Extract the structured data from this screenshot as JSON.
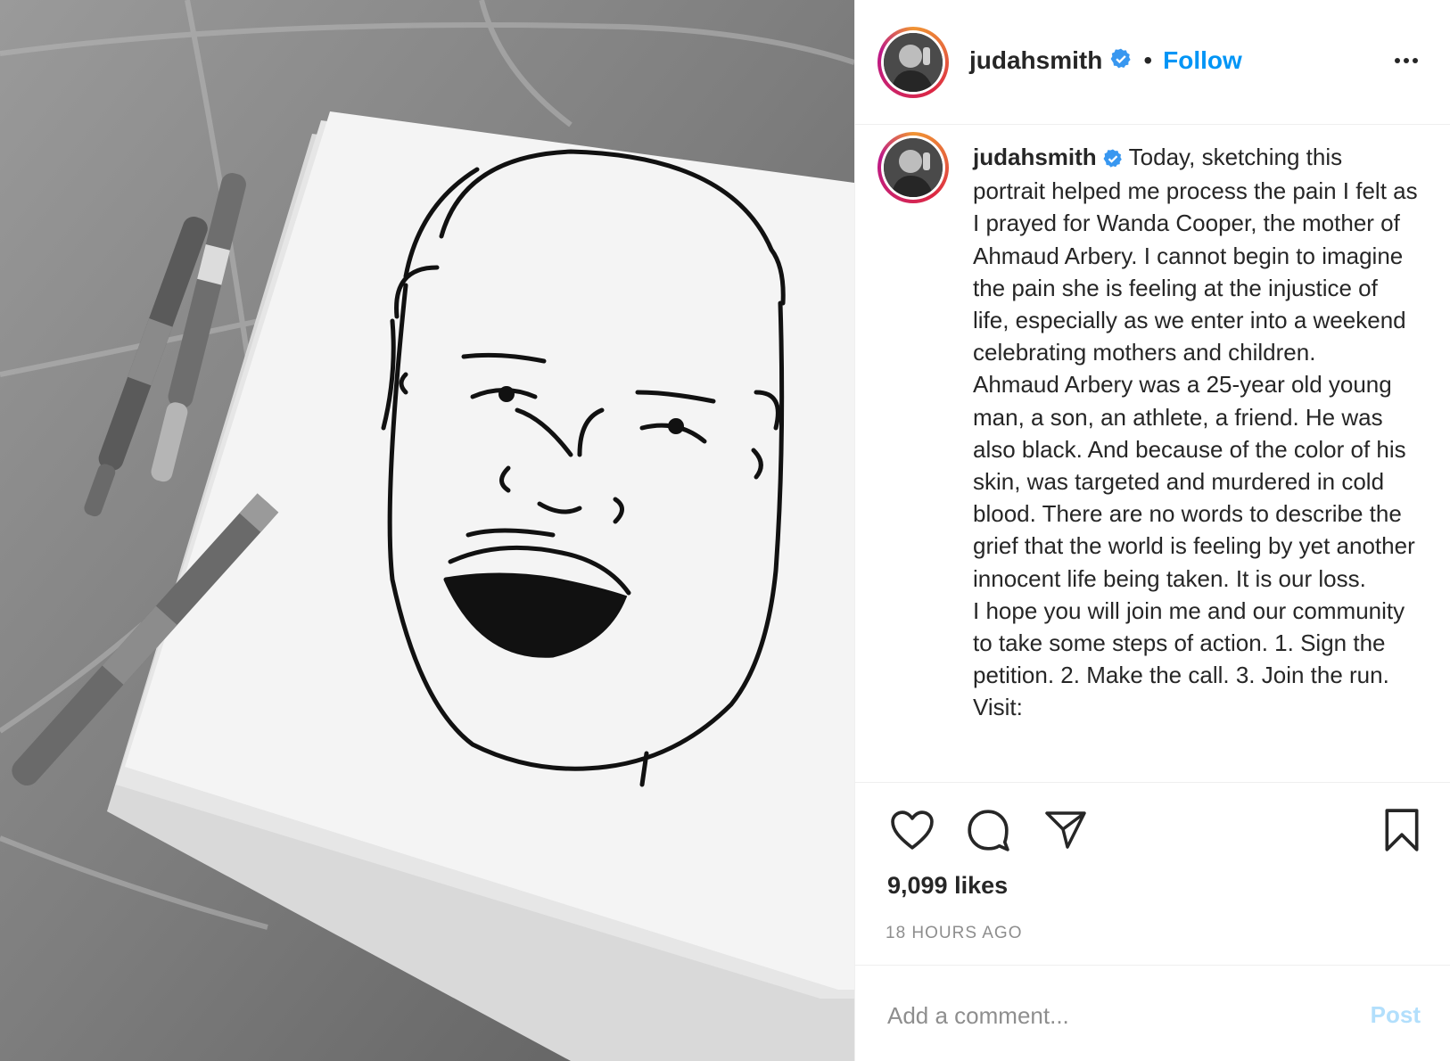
{
  "colors": {
    "accent": "#0095f6",
    "verified": "#3897f0",
    "post_disabled": "#b2dffc",
    "muted": "#8e8e8e",
    "text": "#262626"
  },
  "header": {
    "username": "judahsmith",
    "separator": "•",
    "follow_label": "Follow",
    "more_icon": "more-horizontal-icon"
  },
  "caption": {
    "username": "judahsmith",
    "lines": [
      "Today, sketching this portrait helped me process the pain I felt as I prayed for Wanda Cooper, the mother of Ahmaud Arbery. I cannot begin to imagine the pain she is feeling at the injustice of life, especially as we enter into a weekend celebrating mothers and children.",
      "Ahmaud Arbery was a 25-year old young man, a son, an athlete, a friend. He was also black. And because of the color of his skin, was targeted and murdered in cold blood. There are no words to describe the grief that the world is feeling by yet another innocent life being taken. It is our loss.",
      "I hope you will join me and our community to take some steps of action. 1. Sign the petition. 2. Make the call. 3. Join the run. Visit:"
    ]
  },
  "actions": {
    "like_icon": "heart-icon",
    "comment_icon": "comment-icon",
    "share_icon": "send-icon",
    "save_icon": "bookmark-icon"
  },
  "likes": "9,099 likes",
  "timestamp": "18 HOURS AGO",
  "comment": {
    "placeholder": "Add a comment...",
    "post_label": "Post"
  }
}
